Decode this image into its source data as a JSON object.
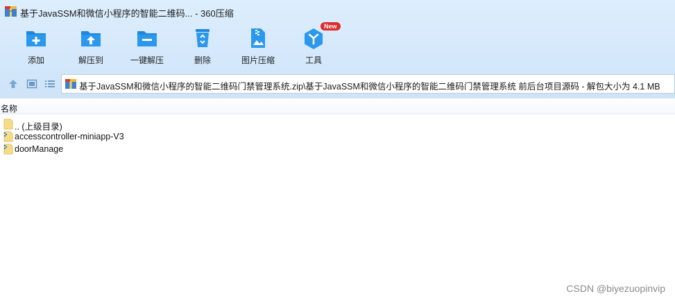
{
  "window": {
    "title": "基于JavaSSM和微信小程序的智能二维码...  - 360压缩"
  },
  "toolbar": {
    "items": [
      {
        "label": "添加",
        "icon": "add-folder-icon"
      },
      {
        "label": "解压到",
        "icon": "extract-to-icon"
      },
      {
        "label": "一键解压",
        "icon": "one-click-extract-icon"
      },
      {
        "label": "删除",
        "icon": "recycle-bin-icon"
      },
      {
        "label": "图片压缩",
        "icon": "image-compress-icon"
      },
      {
        "label": "工具",
        "icon": "tools-cube-icon",
        "badge": "New"
      }
    ]
  },
  "nav": {
    "path": "基于JavaSSM和微信小程序的智能二维码门禁管理系统.zip\\基于JavaSSM和微信小程序的智能二维码门禁管理系统 前后台项目源码 - 解包大小为 4.1 MB"
  },
  "file_list": {
    "column_name": "名称",
    "rows": [
      {
        "name": ".. (上级目录)",
        "icon": "parent-folder-icon"
      },
      {
        "name": "accesscontroller-miniapp-V3",
        "icon": "zip-folder-icon"
      },
      {
        "name": "doorManage",
        "icon": "zip-folder-icon"
      }
    ]
  },
  "watermark": "CSDN @biyezuopinvip",
  "colors": {
    "accent": "#2b8fe4",
    "toolbar_bg": "#d4e8fb",
    "badge": "#e02a2a"
  }
}
